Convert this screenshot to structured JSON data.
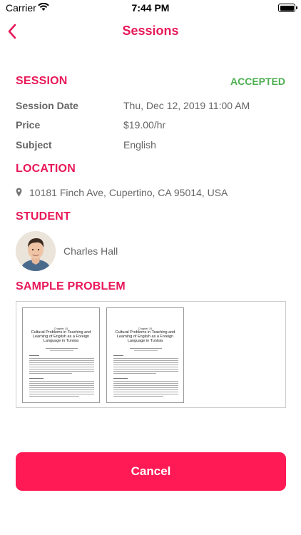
{
  "status_bar": {
    "carrier": "Carrier",
    "time": "7:44 PM"
  },
  "nav": {
    "title": "Sessions",
    "back_icon": "chevron-left-icon"
  },
  "session": {
    "header": "SESSION",
    "status": "ACCEPTED",
    "rows": [
      {
        "label": "Session Date",
        "value": "Thu, Dec 12, 2019 11:00 AM"
      },
      {
        "label": "Price",
        "value": "$19.00/hr"
      },
      {
        "label": "Subject",
        "value": "English"
      }
    ]
  },
  "location": {
    "header": "LOCATION",
    "address": "10181 Finch Ave, Cupertino, CA 95014, USA",
    "icon": "map-pin-icon"
  },
  "student": {
    "header": "STUDENT",
    "name": "Charles Hall"
  },
  "sample_problem": {
    "header": "SAMPLE PROBLEM",
    "documents": [
      {
        "chapter": "Chapter 15",
        "title": "Cultural Problems in Teaching and Learning of English as a Foreign Language in Tunisia"
      },
      {
        "chapter": "Chapter 15",
        "title": "Cultural Problems in Teaching and Learning of English as a Foreign Language in Tunisia"
      }
    ]
  },
  "actions": {
    "cancel_label": "Cancel"
  },
  "colors": {
    "accent": "#e8185a",
    "accepted": "#4caf50",
    "button": "#ff1a55"
  }
}
